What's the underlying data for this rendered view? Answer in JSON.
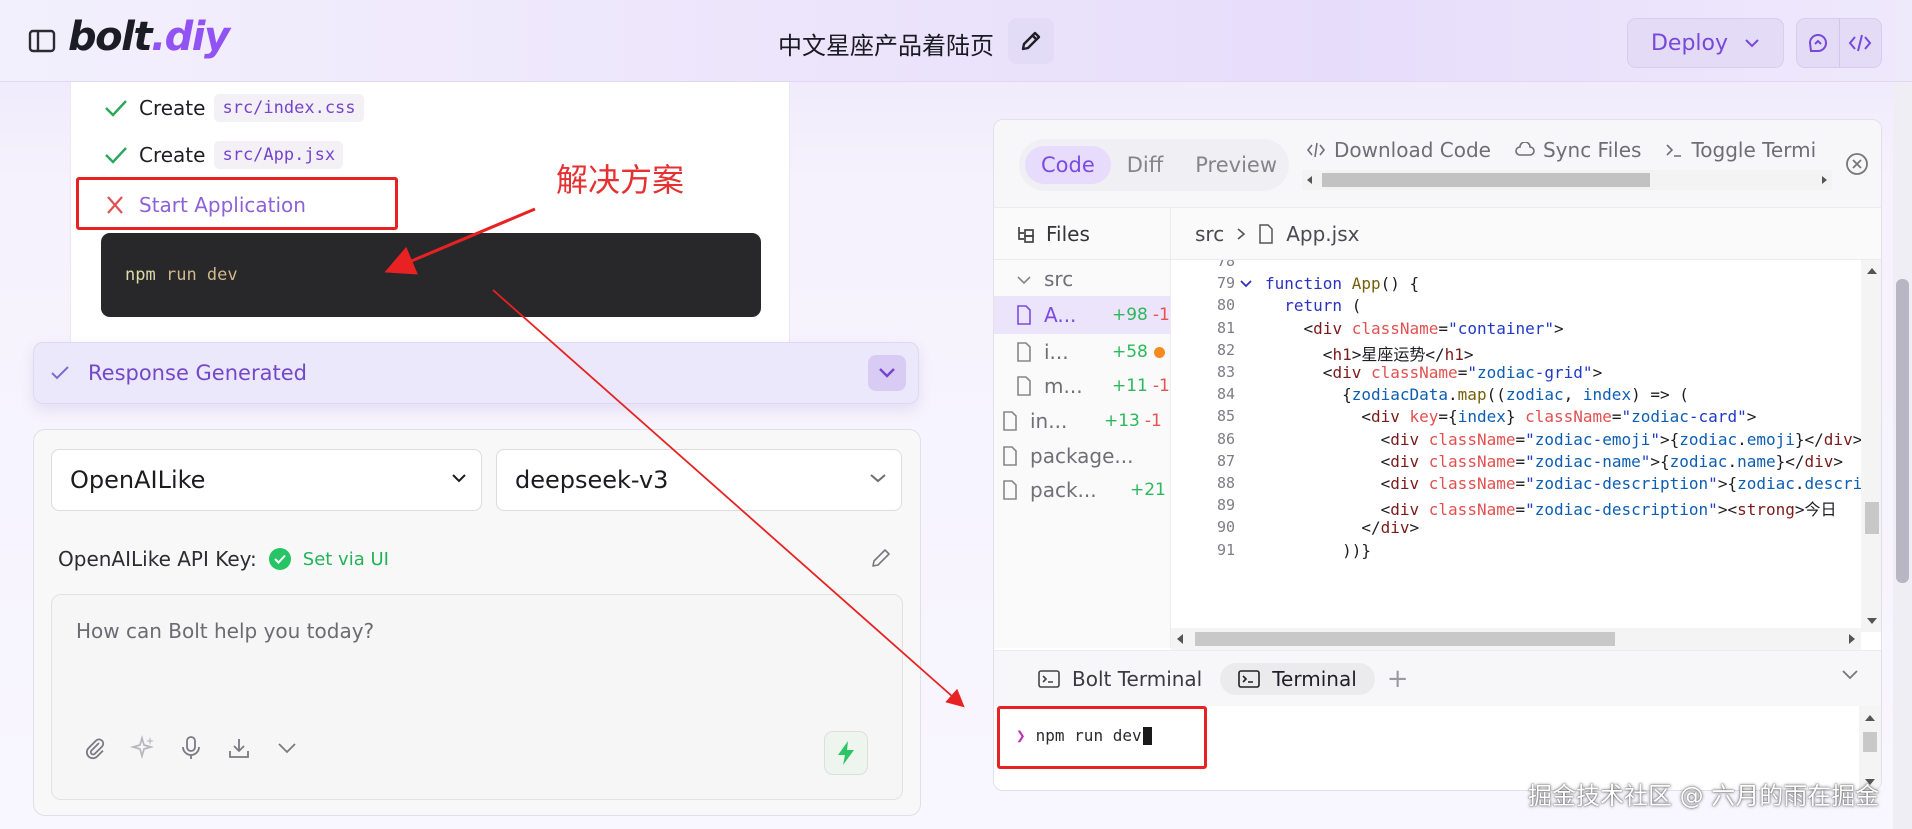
{
  "header": {
    "logo_part1": "bolt",
    "logo_part2": ".diy",
    "project_title": "中文星座产品着陆页",
    "deploy_label": "Deploy"
  },
  "chat": {
    "steps": [
      {
        "label": "Create",
        "file": "src/index.css",
        "status": "done"
      },
      {
        "label": "Create",
        "file": "src/App.jsx",
        "status": "done"
      },
      {
        "label": "Start Application",
        "file": "",
        "status": "failed"
      }
    ],
    "command": {
      "cmd": "npm",
      "args": "run dev"
    },
    "response_status": "Response Generated"
  },
  "input": {
    "provider": "OpenAILike",
    "model": "deepseek-v3",
    "api_key_label": "OpenAILike API Key:",
    "api_key_status": "Set via UI",
    "placeholder": "How can Bolt help you today?"
  },
  "workbench": {
    "views": [
      "Code",
      "Diff",
      "Preview"
    ],
    "active_view": "Code",
    "actions": [
      "Download Code",
      "Sync Files",
      "Toggle Termi"
    ],
    "files_label": "Files",
    "breadcrumb": {
      "folder": "src",
      "file": "App.jsx"
    },
    "tree": [
      {
        "name": "src",
        "type": "folder",
        "added": "",
        "removed": ""
      },
      {
        "name": "A...",
        "type": "file",
        "added": "+98",
        "removed": "-1",
        "active": true
      },
      {
        "name": "i...",
        "type": "file",
        "added": "+58",
        "removed": "",
        "modified_dot": true
      },
      {
        "name": "m...",
        "type": "file",
        "added": "+11",
        "removed": "-1"
      },
      {
        "name": "in...",
        "type": "file",
        "added": "+13",
        "removed": "-1"
      },
      {
        "name": "package...",
        "type": "file",
        "added": "",
        "removed": ""
      },
      {
        "name": "pack...",
        "type": "file",
        "added": "+21",
        "removed": ""
      }
    ],
    "code_lines": [
      {
        "n": "78",
        "t": ""
      },
      {
        "n": "79",
        "t": "function App() {"
      },
      {
        "n": "80",
        "t": "  return ("
      },
      {
        "n": "81",
        "t": "    <div className=\"container\">"
      },
      {
        "n": "82",
        "t": "      <h1>星座运势</h1>"
      },
      {
        "n": "83",
        "t": "      <div className=\"zodiac-grid\">"
      },
      {
        "n": "84",
        "t": "        {zodiacData.map((zodiac, index) => ("
      },
      {
        "n": "85",
        "t": "          <div key={index} className=\"zodiac-card\">"
      },
      {
        "n": "86",
        "t": "            <div className=\"zodiac-emoji\">{zodiac.emoji}</div>"
      },
      {
        "n": "87",
        "t": "            <div className=\"zodiac-name\">{zodiac.name}</div>"
      },
      {
        "n": "88",
        "t": "            <div className=\"zodiac-description\">{zodiac.description}</div>"
      },
      {
        "n": "89",
        "t": "            <div className=\"zodiac-description\"><strong>今日"
      },
      {
        "n": "90",
        "t": "          </div>"
      },
      {
        "n": "91",
        "t": "        ))}"
      }
    ],
    "terminal_tabs": [
      "Bolt Terminal",
      "Terminal"
    ],
    "active_terminal": "Terminal",
    "terminal_line": "npm run dev"
  },
  "annotations": {
    "label": "解决方案",
    "watermark": "掘金技术社区 @ 六月的雨在掘金"
  },
  "colors": {
    "accent": "#7b4be0",
    "annotation": "#e82222",
    "success": "#27c466"
  }
}
